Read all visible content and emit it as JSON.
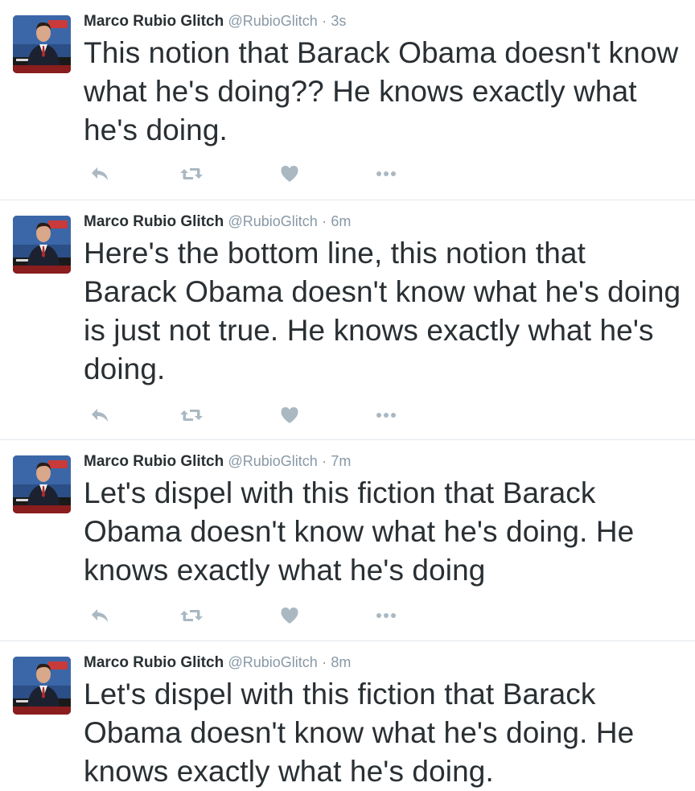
{
  "colors": {
    "text": "#292f33",
    "meta": "#8899a6",
    "icon": "#aab8c2",
    "divider": "#e1e8ed"
  },
  "icons": {
    "reply": "reply-icon",
    "retweet": "retweet-icon",
    "like": "heart-icon",
    "more": "more-icon"
  },
  "tweets": [
    {
      "name": "Marco Rubio Glitch",
      "handle": "@RubioGlitch",
      "separator": "·",
      "time": "3s",
      "text": "This notion that Barack Obama doesn't know what he's doing?? He knows exactly what he's doing."
    },
    {
      "name": "Marco Rubio Glitch",
      "handle": "@RubioGlitch",
      "separator": "·",
      "time": "6m",
      "text": "Here's the bottom line, this notion that Barack Obama doesn't know what he's doing is just not true. He knows exactly what he's doing."
    },
    {
      "name": "Marco Rubio Glitch",
      "handle": "@RubioGlitch",
      "separator": "·",
      "time": "7m",
      "text": "Let's dispel with this fiction that Barack Obama doesn't know what he's doing. He knows exactly what he's doing"
    },
    {
      "name": "Marco Rubio Glitch",
      "handle": "@RubioGlitch",
      "separator": "·",
      "time": "8m",
      "text": "Let's dispel with this fiction that Barack Obama doesn't know what he's doing. He knows exactly what he's doing."
    }
  ]
}
